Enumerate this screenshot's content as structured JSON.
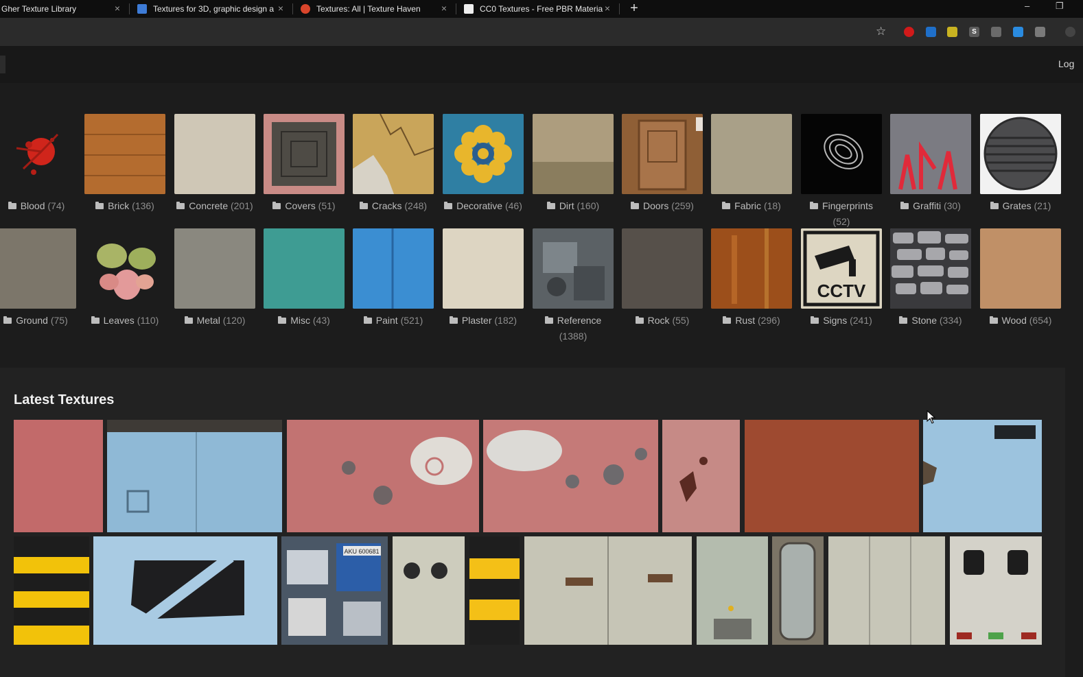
{
  "browser": {
    "tabs": [
      {
        "title": "Gher Texture Library",
        "favicon_color": "#0e0e0e"
      },
      {
        "title": "Textures for 3D, graphic design a",
        "favicon_color": "#3d7bd6"
      },
      {
        "title": "Textures: All | Texture Haven",
        "favicon_color": "#d9452b"
      },
      {
        "title": "CC0 Textures - Free PBR Materia",
        "favicon_color": "#eeeeee"
      }
    ],
    "new_tab_symbol": "+",
    "window_minimize": "–",
    "window_restore": "❐"
  },
  "toolbar": {
    "bookmark_icon": "star-icon",
    "extensions": [
      {
        "icon": "ublock-icon",
        "color": "#d11a1a",
        "glyph": ""
      },
      {
        "icon": "translate-icon",
        "color": "#1f6fc9",
        "glyph": ""
      },
      {
        "icon": "notes-icon",
        "color": "#c9b321",
        "glyph": ""
      },
      {
        "icon": "s-extension-icon",
        "color": "#5c5c5c",
        "glyph": "S"
      },
      {
        "icon": "eye-dropper-icon",
        "color": "#6a6a6a",
        "glyph": ""
      },
      {
        "icon": "dropbox-icon",
        "color": "#2a8be0",
        "glyph": ""
      },
      {
        "icon": "clipboard-icon",
        "color": "#7a7a7a",
        "glyph": ""
      }
    ]
  },
  "site_header": {
    "login_label": "Log"
  },
  "categories": [
    {
      "name": "Blood",
      "count": "(74)"
    },
    {
      "name": "Brick",
      "count": "(136)"
    },
    {
      "name": "Concrete",
      "count": "(201)"
    },
    {
      "name": "Covers",
      "count": "(51)"
    },
    {
      "name": "Cracks",
      "count": "(248)"
    },
    {
      "name": "Decorative",
      "count": "(46)"
    },
    {
      "name": "Dirt",
      "count": "(160)"
    },
    {
      "name": "Doors",
      "count": "(259)"
    },
    {
      "name": "Fabric",
      "count": "(18)"
    },
    {
      "name": "Fingerprints",
      "count": "(52)"
    },
    {
      "name": "Graffiti",
      "count": "(30)"
    },
    {
      "name": "Grates",
      "count": "(21)"
    },
    {
      "name": "Ground",
      "count": "(75)"
    },
    {
      "name": "Leaves",
      "count": "(110)"
    },
    {
      "name": "Metal",
      "count": "(120)"
    },
    {
      "name": "Misc",
      "count": "(43)"
    },
    {
      "name": "Paint",
      "count": "(521)"
    },
    {
      "name": "Plaster",
      "count": "(182)"
    },
    {
      "name": "Reference",
      "count": "(1388)"
    },
    {
      "name": "Rock",
      "count": "(55)"
    },
    {
      "name": "Rust",
      "count": "(296)"
    },
    {
      "name": "Signs",
      "count": "(241)"
    },
    {
      "name": "Stone",
      "count": "(334)"
    },
    {
      "name": "Wood",
      "count": "(654)"
    }
  ],
  "cctv_sign_text": "CCTV",
  "sticker_text": "AKU 600681",
  "latest": {
    "title": "Latest Textures"
  }
}
